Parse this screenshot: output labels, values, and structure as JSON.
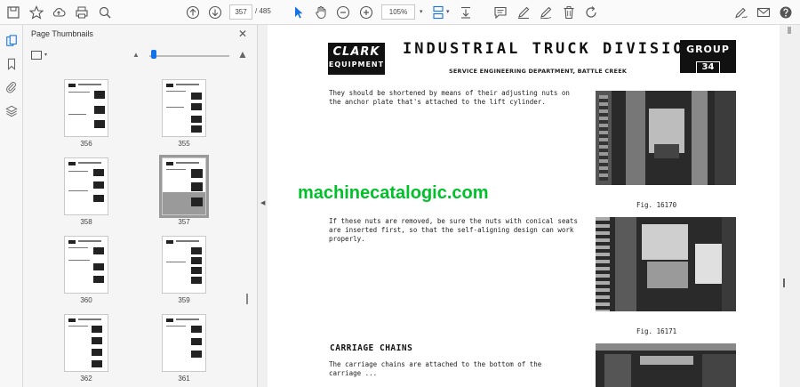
{
  "toolbar": {
    "current_page": "357",
    "page_total": "/ 485",
    "zoom": "105%"
  },
  "panel": {
    "title": "Page Thumbnails"
  },
  "thumbnails": [
    {
      "label": "356"
    },
    {
      "label": "355"
    },
    {
      "label": "358"
    },
    {
      "label": "357"
    },
    {
      "label": "360"
    },
    {
      "label": "359"
    },
    {
      "label": "362"
    },
    {
      "label": "361"
    }
  ],
  "document": {
    "logo_line1": "CLARK",
    "logo_line2": "EQUIPMENT",
    "title": "INDUSTRIAL TRUCK DIVISION",
    "subtitle": "SERVICE ENGINEERING DEPARTMENT, BATTLE CREEK",
    "group_label": "GROUP",
    "group_number": "34",
    "para1": [
      "They should be shortened by means of their adjusting nuts on",
      "the anchor plate that's attached to the lift cylinder."
    ],
    "para2": [
      "If these nuts are removed, be sure the nuts with conical seats",
      "are inserted first, so that the self-aligning design can work",
      "properly."
    ],
    "section_heading": "CARRIAGE CHAINS",
    "para3": [
      "The carriage chains are attached to the bottom of the",
      "carriage ..."
    ],
    "fig1": "Fig. 16170",
    "fig2": "Fig. 16171",
    "watermark": "machinecatalogic.com"
  },
  "icons": {
    "accent": "#1473e6"
  }
}
